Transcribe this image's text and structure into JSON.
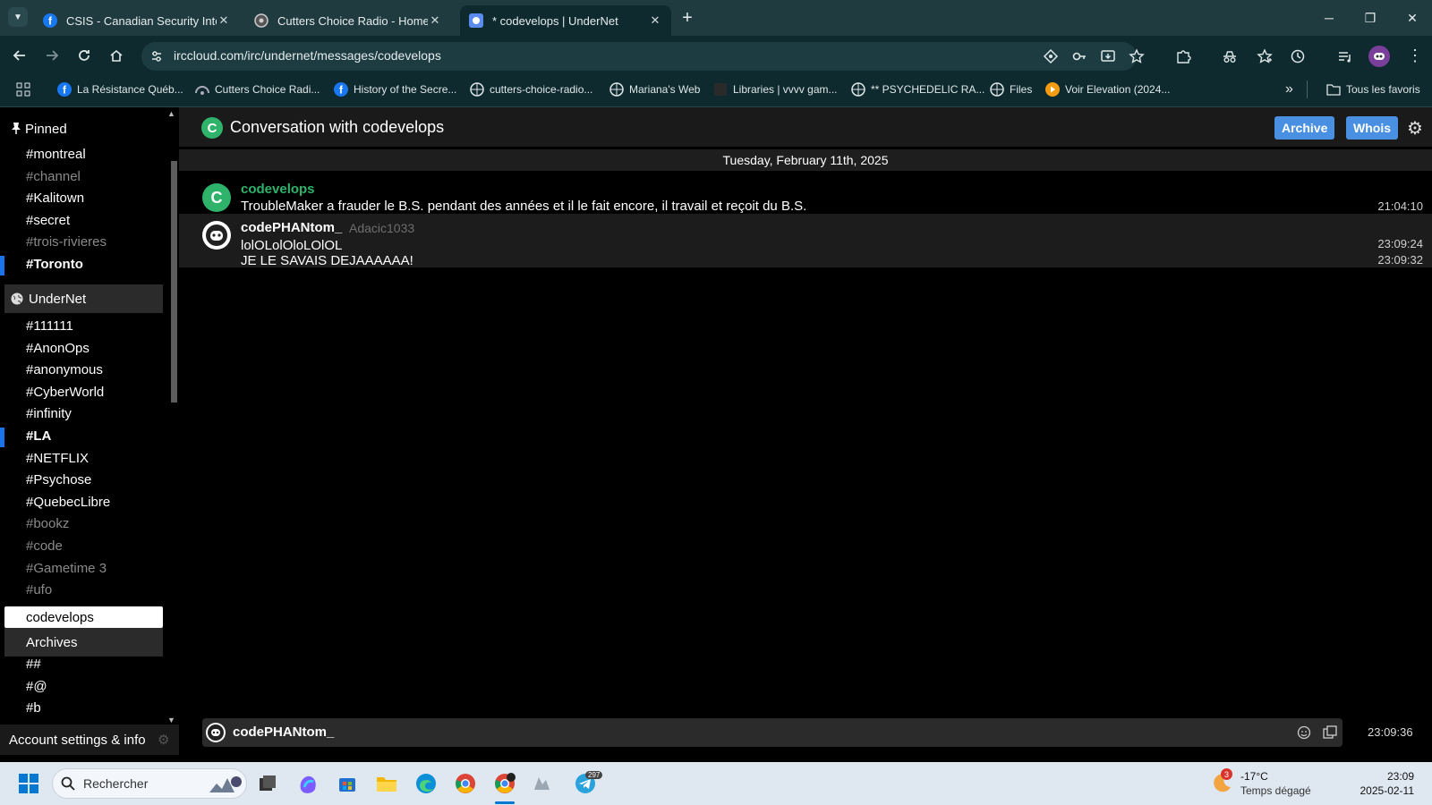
{
  "browser": {
    "tabs": [
      {
        "title": "CSIS - Canadian Security Intellig",
        "icon": "facebook-icon",
        "active": false
      },
      {
        "title": "Cutters Choice Radio - Home o",
        "icon": "radio-icon",
        "active": false
      },
      {
        "title": "* codevelops | UnderNet",
        "icon": "irccloud-icon",
        "active": true
      }
    ],
    "url": "irccloud.com/irc/undernet/messages/codevelops",
    "bookmarks": [
      {
        "label": "La Résistance Québ...",
        "icon": "facebook-icon"
      },
      {
        "label": "Cutters Choice Radi...",
        "icon": "radio-icon"
      },
      {
        "label": "History of the Secre...",
        "icon": "facebook-icon"
      },
      {
        "label": "cutters-choice-radio...",
        "icon": "globe-icon"
      },
      {
        "label": "Mariana's Web",
        "icon": "globe-icon"
      },
      {
        "label": "Libraries | vvvv gam...",
        "icon": "page-icon"
      },
      {
        "label": "** PSYCHEDELIC RA...",
        "icon": "globe-icon"
      },
      {
        "label": "Files",
        "icon": "globe-icon"
      },
      {
        "label": "Voir Elevation (2024...",
        "icon": "play-icon"
      }
    ],
    "bookmarks_overflow": "»",
    "all_bookmarks": "Tous les favoris"
  },
  "sidebar": {
    "pinned_label": "Pinned",
    "pinned": [
      {
        "name": "#montreal",
        "style": "normal"
      },
      {
        "name": "#channel",
        "style": "dim"
      },
      {
        "name": "#Kalitown",
        "style": "normal"
      },
      {
        "name": "#secret",
        "style": "normal"
      },
      {
        "name": "#trois-rivieres",
        "style": "dim"
      },
      {
        "name": "#Toronto",
        "style": "bold"
      }
    ],
    "network_label": "UnderNet",
    "channels": [
      {
        "name": "#111111",
        "style": "normal"
      },
      {
        "name": "#AnonOps",
        "style": "normal"
      },
      {
        "name": "#anonymous",
        "style": "normal"
      },
      {
        "name": "#CyberWorld",
        "style": "normal"
      },
      {
        "name": "#infinity",
        "style": "normal"
      },
      {
        "name": "#LA",
        "style": "bold"
      },
      {
        "name": "#NETFLIX",
        "style": "normal"
      },
      {
        "name": "#Psychose",
        "style": "normal"
      },
      {
        "name": "#QuebecLibre",
        "style": "normal"
      },
      {
        "name": "#bookz",
        "style": "dim"
      },
      {
        "name": "#code",
        "style": "dim"
      },
      {
        "name": "#Gametime 3",
        "style": "dim"
      },
      {
        "name": "#ufo",
        "style": "dim"
      }
    ],
    "selected": "codevelops",
    "archives_label": "Archives",
    "archived": [
      "##",
      "#@",
      "#b"
    ],
    "account_label": "Account settings & info"
  },
  "conversation": {
    "avatar_letter": "C",
    "title": "Conversation with codevelops",
    "archive_label": "Archive",
    "whois_label": "Whois",
    "date": "Tuesday, February 11th, 2025",
    "messages": [
      {
        "nick": "codevelops",
        "nick_color": "#2fb36b",
        "realname": "",
        "avatar_letter": "C",
        "lines": [
          {
            "text": "TroubleMaker a frauder le B.S. pendant des années et il le fait encore, il travail et reçoit du B.S.",
            "time": "21:04:10"
          }
        ]
      },
      {
        "nick": "codePHANtom_",
        "nick_color": "#ffffff",
        "realname": "Adacic1033",
        "avatar_letter": "",
        "lines": [
          {
            "text": "lolOLolOloLOlOL",
            "time": "23:09:24"
          },
          {
            "text": "JE LE SAVAIS DEJAAAAAA!",
            "time": "23:09:32"
          }
        ]
      }
    ],
    "input_nick": "codePHANtom_",
    "input_value": "",
    "clock": "23:09:36"
  },
  "taskbar": {
    "search_placeholder": "Rechercher",
    "weather_temp": "-17°C",
    "weather_desc": "Temps dégagé",
    "weather_badge": "3",
    "time": "23:09",
    "date": "2025-02-11",
    "telegram_badge": "297"
  },
  "colors": {
    "accent": "#1a73e8",
    "button": "#4a90e2",
    "nick_green": "#2fb36b"
  }
}
